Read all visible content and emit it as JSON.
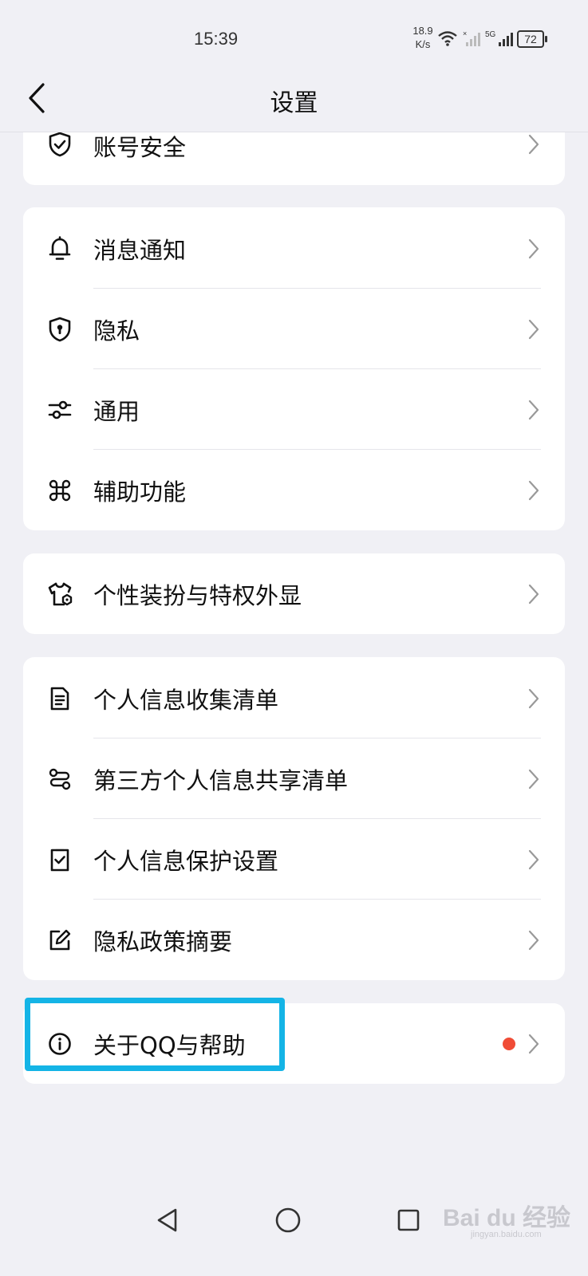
{
  "status_bar": {
    "time": "15:39",
    "net_speed_value": "18.9",
    "net_speed_unit": "K/s",
    "signal_label": "5G",
    "battery": "72"
  },
  "header": {
    "title": "设置"
  },
  "cards": [
    {
      "items": [
        {
          "label": "账号安全",
          "icon": "shield-check-icon"
        }
      ]
    },
    {
      "items": [
        {
          "label": "消息通知",
          "icon": "bell-icon"
        },
        {
          "label": "隐私",
          "icon": "shield-keyhole-icon"
        },
        {
          "label": "通用",
          "icon": "sliders-icon"
        },
        {
          "label": "辅助功能",
          "icon": "command-icon"
        }
      ]
    },
    {
      "items": [
        {
          "label": "个性装扮与特权外显",
          "icon": "shirt-icon"
        }
      ]
    },
    {
      "items": [
        {
          "label": "个人信息收集清单",
          "icon": "document-list-icon"
        },
        {
          "label": "第三方个人信息共享清单",
          "icon": "share-route-icon"
        },
        {
          "label": "个人信息保护设置",
          "icon": "checkbox-doc-icon"
        },
        {
          "label": "隐私政策摘要",
          "icon": "edit-square-icon"
        }
      ]
    },
    {
      "items": [
        {
          "label": "关于QQ与帮助",
          "icon": "info-circle-icon",
          "badge": "red-dot"
        }
      ]
    }
  ],
  "colors": {
    "background": "#F0F0F5",
    "card": "#FFFFFF",
    "highlight_border": "#14B4E6",
    "badge_red": "#F04C36"
  },
  "watermark": {
    "text": "Bai du 经验",
    "sub": "jingyan.baidu.com"
  }
}
